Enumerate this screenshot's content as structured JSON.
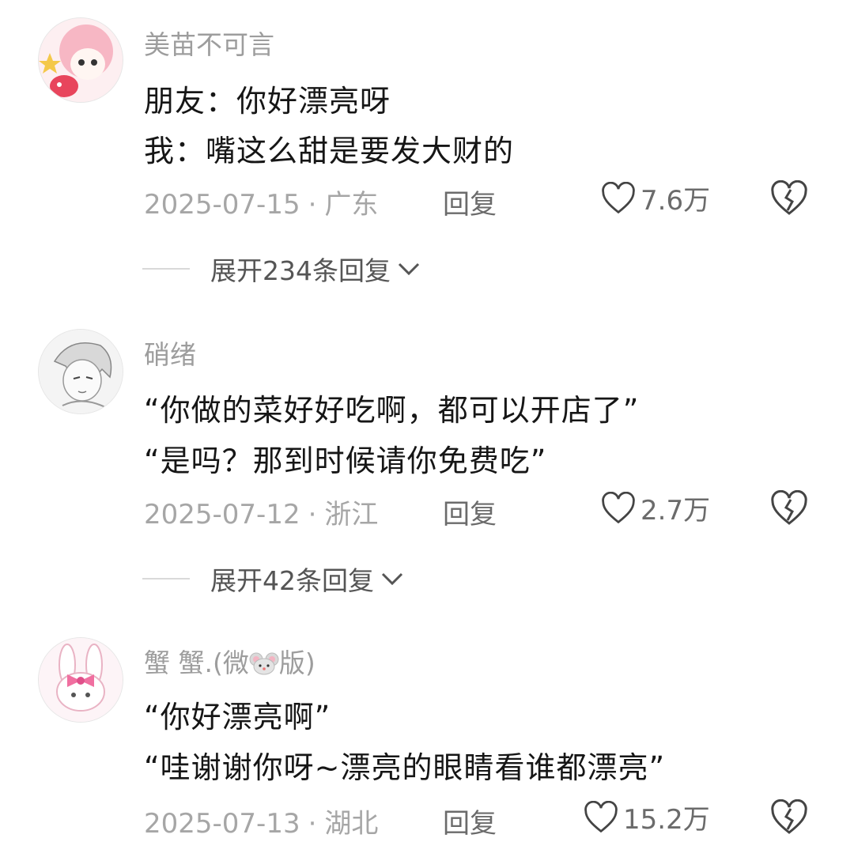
{
  "comments": [
    {
      "username": "美苗不可言",
      "lines": [
        "朋友：你好漂亮呀",
        "我：嘴这么甜是要发大财的"
      ],
      "date": "2025-07-15",
      "location": "广东",
      "reply_label": "回复",
      "likes": "7.6万",
      "expand_label": "展开234条回复"
    },
    {
      "username": "硝绪",
      "lines": [
        "“你做的菜好好吃啊，都可以开店了”",
        "“是吗？那到时候请你免费吃”"
      ],
      "date": "2025-07-12",
      "location": "浙江",
      "reply_label": "回复",
      "likes": "2.7万",
      "expand_label": "展开42条回复"
    },
    {
      "username_prefix": "蟹 蟹.(微",
      "username_suffix": "版)",
      "lines": [
        "“你好漂亮啊”",
        "“哇谢谢你呀~漂亮的眼睛看谁都漂亮”"
      ],
      "date": "2025-07-13",
      "location": "湖北",
      "reply_label": "回复",
      "likes": "15.2万"
    }
  ],
  "separator": "·",
  "icons": {
    "like": "heart-outline-icon",
    "dislike": "broken-heart-icon",
    "expand": "chevron-down-icon",
    "username_emoji": "mouse-emoji-icon"
  }
}
